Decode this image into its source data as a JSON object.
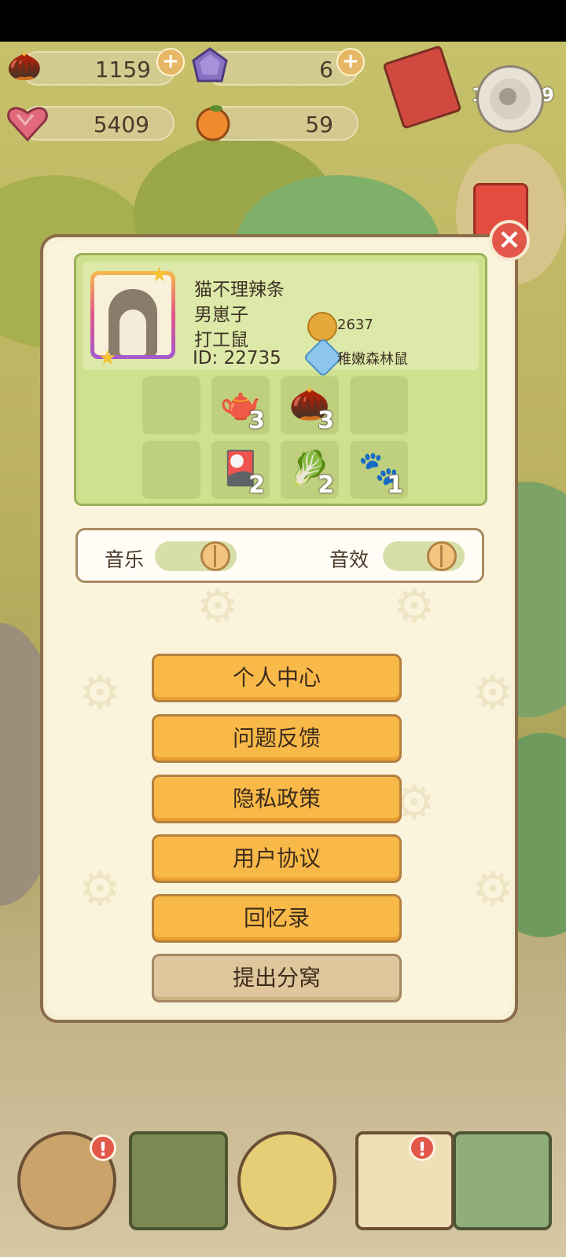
{
  "resources": {
    "acorn": {
      "value": "1159",
      "icon": "acorn-icon"
    },
    "crystal": {
      "value": "6",
      "icon": "purple-crystal-icon"
    },
    "heart": {
      "value": "5409",
      "icon": "heart-icon"
    },
    "orange": {
      "value": "59",
      "icon": "orange-icon"
    }
  },
  "counter": "122479",
  "close_label": "×",
  "profile": {
    "name": "猫不理辣条",
    "gender": "男崽子",
    "title": "打工鼠",
    "id_text": "ID: 22735",
    "bells": "2637",
    "rank": "稚嫩森林鼠"
  },
  "items": [
    {
      "icon": "empty",
      "count": ""
    },
    {
      "icon": "teapot-icon",
      "glyph": "🫖",
      "count": "3"
    },
    {
      "icon": "acorn-cup-icon",
      "glyph": "🌰",
      "count": "3"
    },
    {
      "icon": "empty",
      "count": ""
    },
    {
      "icon": "empty",
      "count": ""
    },
    {
      "icon": "cards-icon",
      "glyph": "🎴",
      "count": "2"
    },
    {
      "icon": "turnip-icon",
      "glyph": "🥬",
      "count": "2"
    },
    {
      "icon": "paw-icon",
      "glyph": "🐾",
      "count": "1"
    }
  ],
  "settings": {
    "music_label": "音乐",
    "sfx_label": "音效"
  },
  "menu": [
    "个人中心",
    "问题反馈",
    "隐私政策",
    "用户协议",
    "回忆录",
    "提出分窝"
  ],
  "alert_mark": "!",
  "colors": {
    "accent": "#f9b948",
    "close": "#e2574a",
    "card": "#cfe08f"
  }
}
